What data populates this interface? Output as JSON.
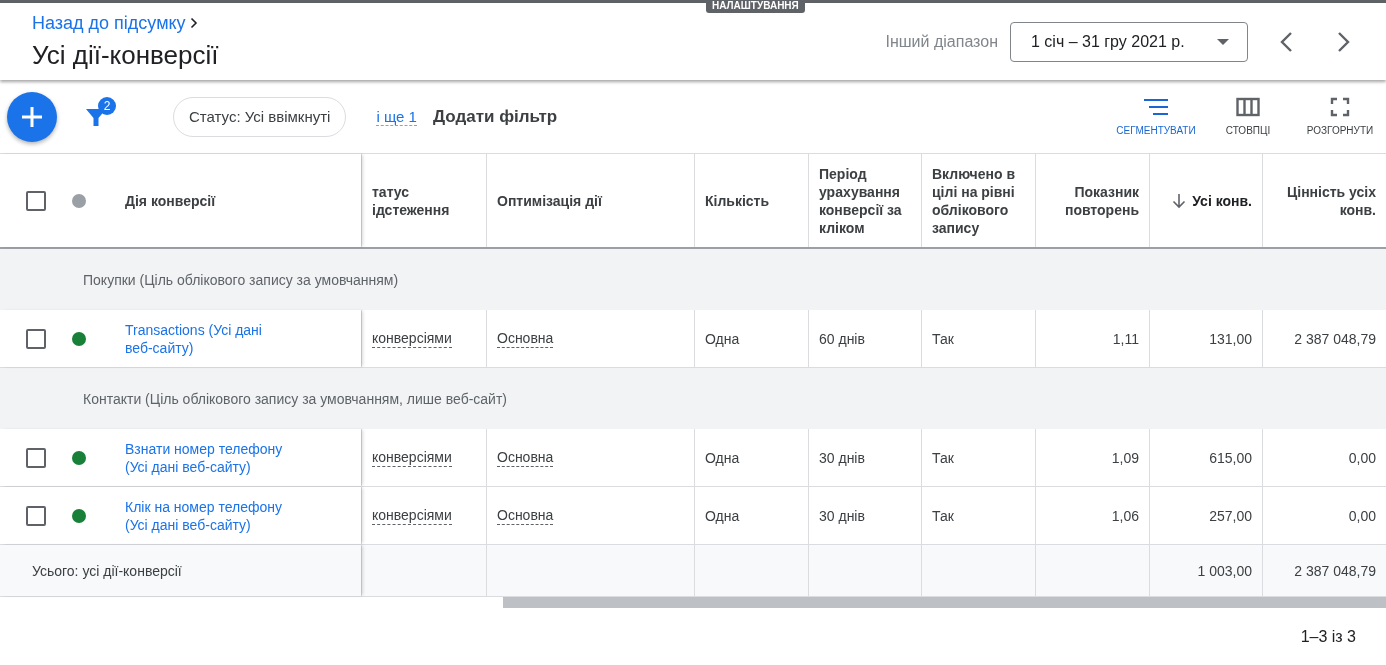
{
  "top_label": "НАЛАШТУВАННЯ",
  "header": {
    "back_link": "Назад до підсумку",
    "title": "Усі дії-конверсії",
    "range_label": "Інший діапазон",
    "date_range": "1 січ – 31 гру 2021 р."
  },
  "toolbar": {
    "filter_count": "2",
    "filters": [
      {
        "label": "Статус: Усі ввімкнуті"
      }
    ],
    "more_filters": "і ще 1",
    "add_filter": "Додати фільтр",
    "actions": [
      {
        "label": "СЕГМЕНТУВАТИ",
        "kind": "segment",
        "selected": true
      },
      {
        "label": "СТОВПЦІ",
        "kind": "columns",
        "selected": false
      },
      {
        "label": "РОЗГОРНУТИ",
        "kind": "expand",
        "selected": false
      }
    ]
  },
  "table": {
    "select_all": {
      "checked": false
    },
    "columns": [
      {
        "label": "Дія конверсії",
        "kind": "text",
        "sorted": false
      },
      {
        "label": "татус ідстеження",
        "kind": "dashed",
        "sorted": false
      },
      {
        "label": "Оптимізація дії",
        "kind": "dashed",
        "sorted": false
      },
      {
        "label": "Кількість",
        "kind": "text",
        "sorted": false
      },
      {
        "label": "Період урахування конверсії за кліком",
        "kind": "text",
        "sorted": false
      },
      {
        "label": "Включено в цілі на рівні облікового запису",
        "kind": "text",
        "sorted": false
      },
      {
        "label": "Показник повторень",
        "kind": "number",
        "sorted": false
      },
      {
        "label": "Усі конв.",
        "kind": "number",
        "sorted": true
      },
      {
        "label": "Цінність усіх конв.",
        "kind": "number",
        "sorted": false
      }
    ],
    "groups": [
      {
        "title": "Покупки (Ціль облікового запису за умовчанням)",
        "rows": [
          {
            "checked": false,
            "color": "#188038",
            "cells": [
              "Transactions (Усі дані веб-сайту)",
              "конверсіями",
              "Основна",
              "Одна",
              "60 днів",
              "Так",
              "1,11",
              "131,00",
              "2 387 048,79"
            ]
          }
        ]
      },
      {
        "title": "Контакти (Ціль облікового запису за умовчанням, лише веб-сайт)",
        "rows": [
          {
            "checked": false,
            "color": "#188038",
            "cells": [
              "Взнати номер телефону (Усі дані веб-сайту)",
              "конверсіями",
              "Основна",
              "Одна",
              "30 днів",
              "Так",
              "1,09",
              "615,00",
              "0,00"
            ]
          },
          {
            "checked": false,
            "color": "#188038",
            "cells": [
              "Клік на номер телефону (Усі дані веб-сайту)",
              "конверсіями",
              "Основна",
              "Одна",
              "30 днів",
              "Так",
              "1,06",
              "257,00",
              "0,00"
            ]
          }
        ]
      }
    ],
    "total": {
      "cells": [
        "Усього: усі дії-конверсії",
        "",
        "",
        "",
        "",
        "",
        "",
        "1 003,00",
        "2 387 048,79"
      ]
    }
  },
  "pagination": "1–3 із 3"
}
